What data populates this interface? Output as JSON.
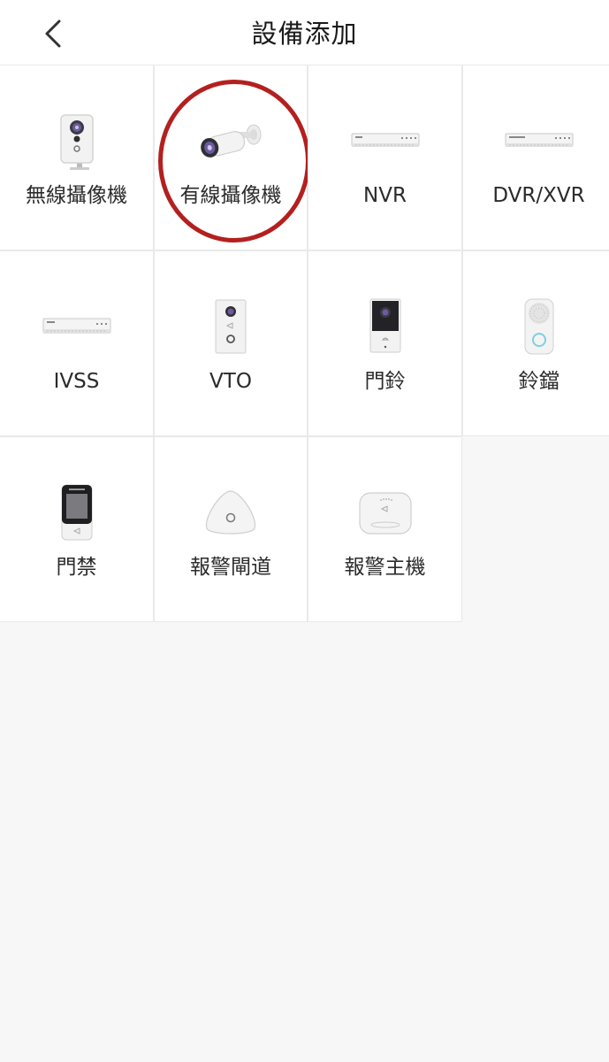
{
  "header": {
    "title": "設備添加",
    "back_icon": "chevron-left-icon"
  },
  "devices": [
    {
      "label": "無線攝像機",
      "icon": "wireless-camera-icon"
    },
    {
      "label": "有線攝像機",
      "icon": "bullet-camera-icon"
    },
    {
      "label": "NVR",
      "icon": "nvr-icon"
    },
    {
      "label": "DVR/XVR",
      "icon": "dvr-icon"
    },
    {
      "label": "IVSS",
      "icon": "ivss-icon"
    },
    {
      "label": "VTO",
      "icon": "vto-icon"
    },
    {
      "label": "門鈴",
      "icon": "doorbell-icon"
    },
    {
      "label": "鈴鐺",
      "icon": "chime-icon"
    },
    {
      "label": "門禁",
      "icon": "access-control-icon"
    },
    {
      "label": "報警閘道",
      "icon": "alarm-gateway-icon"
    },
    {
      "label": "報警主機",
      "icon": "alarm-hub-icon"
    }
  ],
  "highlight": {
    "color": "#b3201f",
    "target": "有線攝像機"
  }
}
